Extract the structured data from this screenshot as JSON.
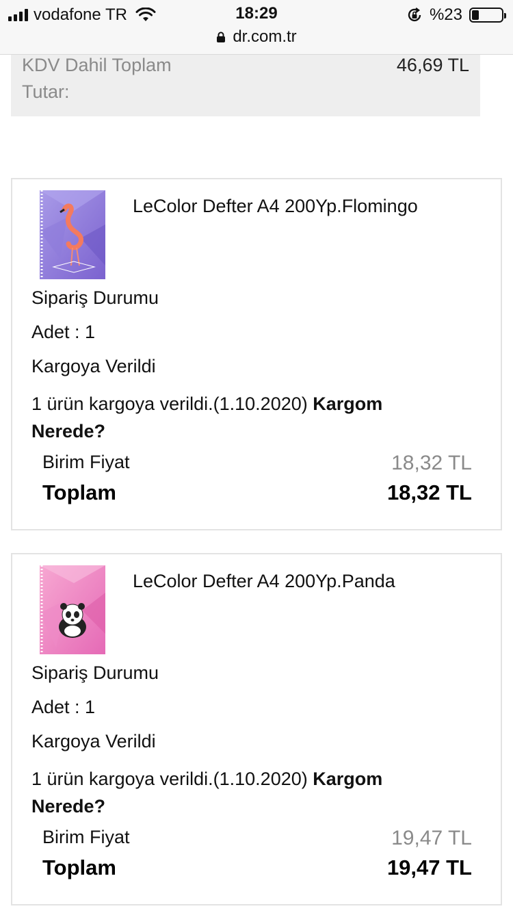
{
  "status_bar": {
    "carrier": "vodafone TR",
    "time": "18:29",
    "battery": "%23",
    "battery_level": 0.23,
    "url": "dr.com.tr"
  },
  "summary": {
    "label": "KDV Dahil Toplam Tutar:",
    "value": "46,69 TL"
  },
  "orders": [
    {
      "product_name": "LeColor Defter A4 200Yp.Flomingo",
      "thumb_icon": "flamingo-notebook-thumbnail",
      "status_title": "Sipariş Durumu",
      "quantity": "Adet : 1",
      "status": "Kargoya Verildi",
      "shipping_text": "1 ürün kargoya verildi.(1.10.2020)",
      "tracking_link": "Kargom Nerede?",
      "unit_price_label": "Birim Fiyat",
      "unit_price": "18,32 TL",
      "total_label": "Toplam",
      "total": "18,32 TL"
    },
    {
      "product_name": "LeColor Defter A4 200Yp.Panda",
      "thumb_icon": "panda-notebook-thumbnail",
      "status_title": "Sipariş Durumu",
      "quantity": "Adet : 1",
      "status": "Kargoya Verildi",
      "shipping_text": "1 ürün kargoya verildi.(1.10.2020)",
      "tracking_link": "Kargom Nerede?",
      "unit_price_label": "Birim Fiyat",
      "unit_price": "19,47 TL",
      "total_label": "Toplam",
      "total": "19,47 TL"
    }
  ],
  "colors": {
    "summary_bg": "#eeeeee",
    "muted_text": "#8a8a8a",
    "card_border": "#e3e3e3"
  }
}
